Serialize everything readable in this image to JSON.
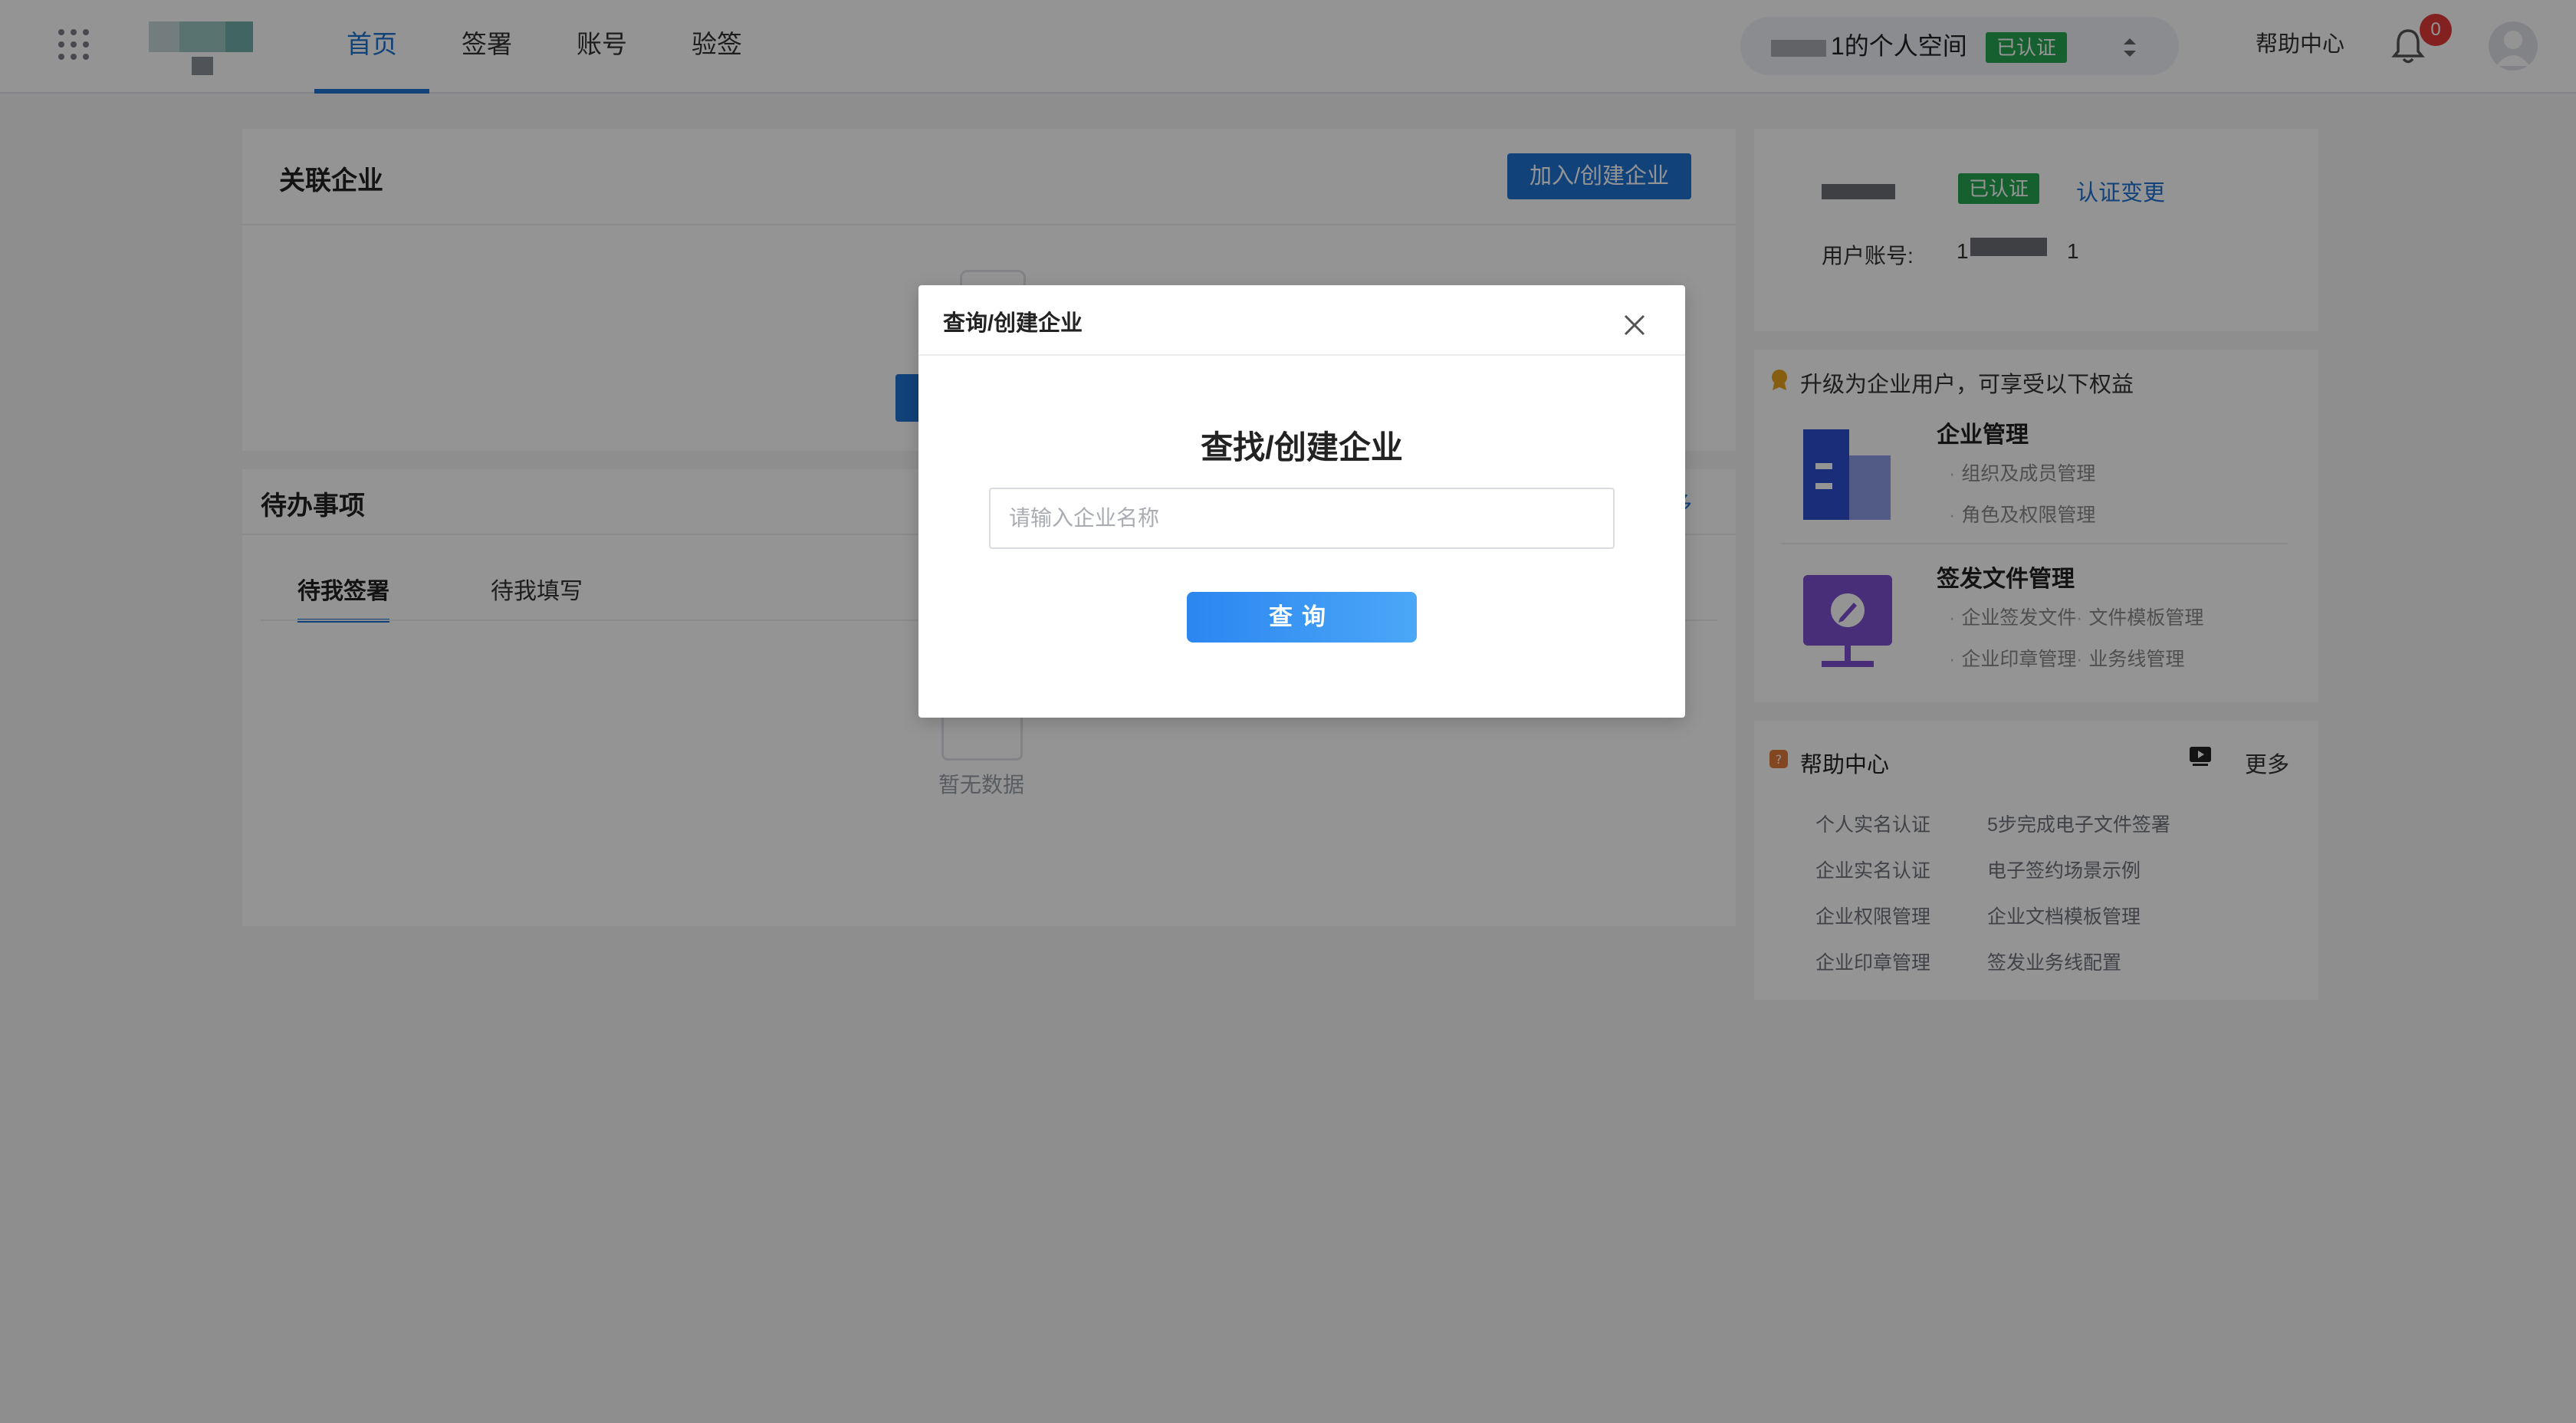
{
  "nav": {
    "items": [
      {
        "label": "首页",
        "active": true
      },
      {
        "label": "签署",
        "active": false
      },
      {
        "label": "账号",
        "active": false
      },
      {
        "label": "验签",
        "active": false
      }
    ]
  },
  "header": {
    "space_name": "1的个人空间",
    "space_badge": "已认证",
    "help": "帮助中心",
    "notification_count": "0"
  },
  "related": {
    "title": "关联企业",
    "join_button": "加入/创建企业"
  },
  "todo": {
    "title": "待办事项",
    "tabs": [
      "待我签署",
      "待我填写"
    ],
    "more_fragment": "多",
    "empty": "暂无数据"
  },
  "profile": {
    "badge": "已认证",
    "change_link": "认证变更",
    "account_label": "用户账号:",
    "account_value_start": "1",
    "account_value_end": "1"
  },
  "upgrade": {
    "title": "升级为企业用户，可享受以下权益",
    "sections": [
      {
        "title": "企业管理",
        "items": [
          "组织及成员管理",
          "角色及权限管理"
        ]
      },
      {
        "title": "签发文件管理",
        "items": [
          "企业签发文件",
          "文件模板管理",
          "企业印章管理",
          "业务线管理"
        ]
      }
    ]
  },
  "help_center": {
    "title": "帮助中心",
    "more": "更多",
    "links": [
      [
        "个人实名认证",
        "5步完成电子文件签署"
      ],
      [
        "企业实名认证",
        "电子签约场景示例"
      ],
      [
        "企业权限管理",
        "企业文档模板管理"
      ],
      [
        "企业印章管理",
        "签发业务线配置"
      ]
    ]
  },
  "modal": {
    "header_title": "查询/创建企业",
    "heading": "查找/创建企业",
    "input_placeholder": "请输入企业名称",
    "input_value": "",
    "search_button": "查询"
  },
  "colors": {
    "primary": "#1f73d3",
    "success": "#27a553",
    "danger": "#e23a3a"
  }
}
